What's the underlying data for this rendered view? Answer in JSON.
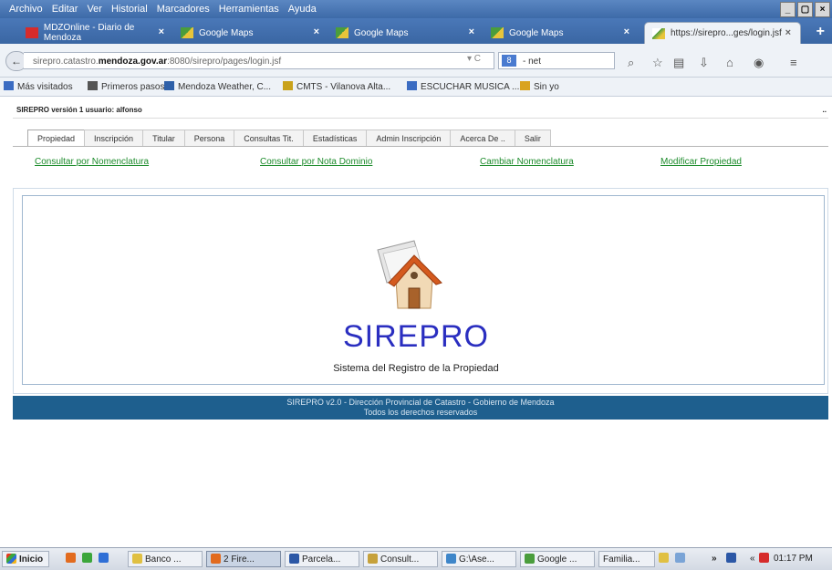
{
  "menu": [
    "Archivo",
    "Editar",
    "Ver",
    "Historial",
    "Marcadores",
    "Herramientas",
    "Ayuda"
  ],
  "window_buttons": [
    "_",
    "▢",
    "×"
  ],
  "tabs": [
    {
      "label": "MDZOnline - Diario de Mendoza",
      "close": "×"
    },
    {
      "label": "Google Maps",
      "close": "×"
    },
    {
      "label": "Google Maps",
      "close": "×"
    },
    {
      "label": "Google Maps",
      "close": "×"
    },
    {
      "label": "https://sirepro...ges/login.jsf",
      "close": "×"
    }
  ],
  "new_tab": "+",
  "nav": {
    "back": "←",
    "url_prefix": "sirepro.catastro.",
    "url_domain": "mendoza.gov.ar",
    "url_suffix": ":8080/sirepro/pages/login.jsf",
    "url_controls": "▾ C",
    "search_badge": "8",
    "search_value": "- net"
  },
  "bookmarks": [
    {
      "label": "Más visitados",
      "color": "#3b6cc2"
    },
    {
      "label": "Primeros pasos",
      "color": "#555555"
    },
    {
      "label": "Mendoza Weather, C...",
      "color": "#2d5fa8"
    },
    {
      "label": "CMTS - Vilanova Alta...",
      "color": "#c9a21b"
    },
    {
      "label": "ESCUCHAR MUSICA ...",
      "color": "#3b6cc2"
    },
    {
      "label": "Sin yo",
      "color": "#d9a320"
    }
  ],
  "page": {
    "header": "SIREPRO versión 1 usuario: alfonso",
    "header_dots": "..",
    "app_tabs": [
      "Propiedad",
      "Inscripción",
      "Titular",
      "Persona",
      "Consultas Tit.",
      "Estadísticas",
      "Admin Inscripción",
      "Acerca De ..",
      "Salir"
    ],
    "sub_links": [
      "Consultar por Nomenclatura",
      "Consultar por Nota Dominio",
      "Cambiar Nomenclatura",
      "Modificar Propiedad"
    ],
    "system_name": "SIREPRO",
    "system_subtitle": "Sistema del Registro de la Propiedad",
    "footer_line1": "SIREPRO v2.0 - Dirección Provincial de Catastro - Gobierno de Mendoza",
    "footer_line2": "Todos los derechos reservados"
  },
  "taskbar": {
    "start": "Inicio",
    "buttons": [
      "Banco ...",
      "2 Fire...",
      "Parcela...",
      "Consult...",
      "G:\\Ase...",
      "Google ...",
      "Familia..."
    ],
    "tray_more": "»",
    "tray_flag": "«",
    "clock": "01:17 PM"
  }
}
